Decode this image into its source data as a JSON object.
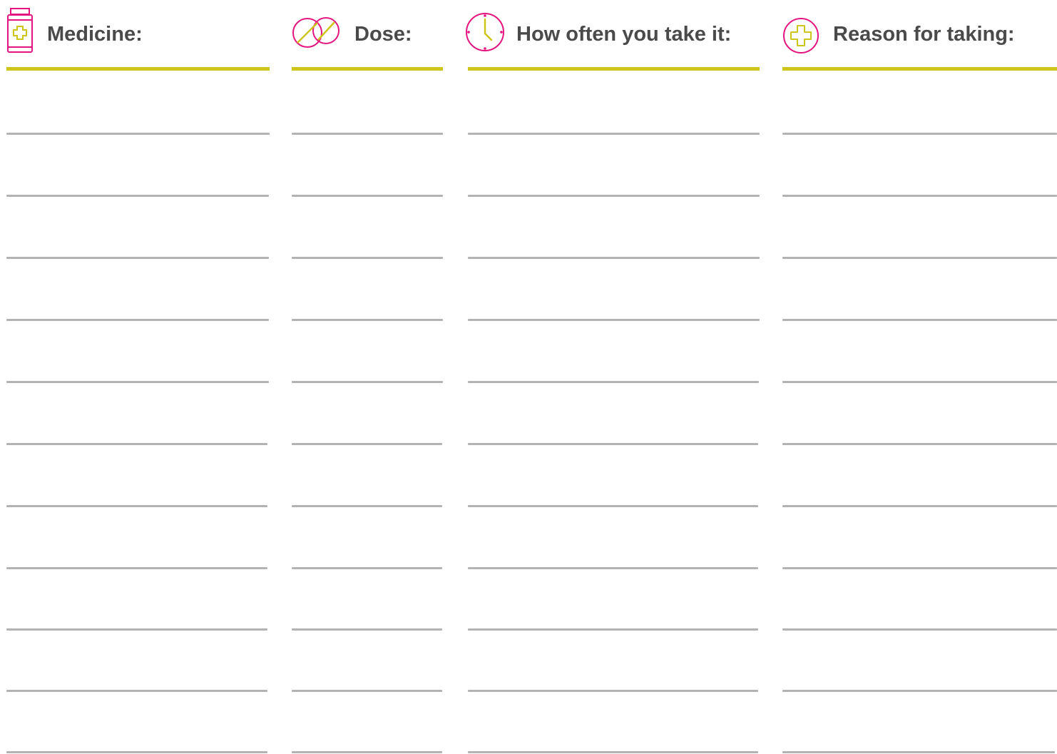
{
  "form": {
    "columns": [
      {
        "key": "medicine",
        "label": "Medicine:",
        "icon": "medicine-bottle-icon"
      },
      {
        "key": "dose",
        "label": "Dose:",
        "icon": "pills-icon"
      },
      {
        "key": "frequency",
        "label": "How often you take it:",
        "icon": "clock-icon"
      },
      {
        "key": "reason",
        "label": "Reason for taking:",
        "icon": "medical-cross-icon"
      }
    ],
    "colors": {
      "accent_magenta": "#e5157f",
      "accent_yellow": "#cdc619",
      "header_text": "#4a4a4a",
      "line_gray": "#b3b3b3"
    },
    "rows_per_column": 11
  }
}
